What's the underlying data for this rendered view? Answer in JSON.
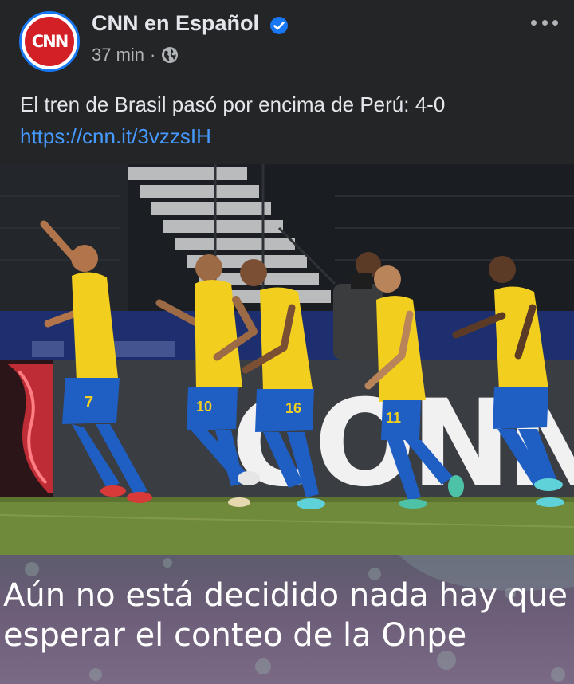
{
  "post": {
    "avatar_text": "CNN",
    "page_name": "CNN en Español",
    "time": "37 min",
    "separator": "·",
    "text": "El tren de Brasil pasó por encima de Perú: 4-0",
    "link": "https://cnn.it/3vzzsIH"
  },
  "photo": {
    "jersey_numbers": [
      "7",
      "10",
      "16",
      "11"
    ],
    "board_text": "CONN"
  },
  "caption": {
    "line1": "Aún no está decidido nada hay que",
    "line2": "esperar el conteo de la Onpe"
  },
  "colors": {
    "header_bg": "#242526",
    "link": "#4599ff",
    "verified": "#1877f2",
    "brand_red": "#d31f26",
    "jersey_yellow": "#f2cf1f",
    "shorts_blue": "#1f5fc4",
    "pitch_green": "#6f8a3a"
  },
  "icons": [
    "verified-icon",
    "globe-icon",
    "more-options-icon"
  ]
}
